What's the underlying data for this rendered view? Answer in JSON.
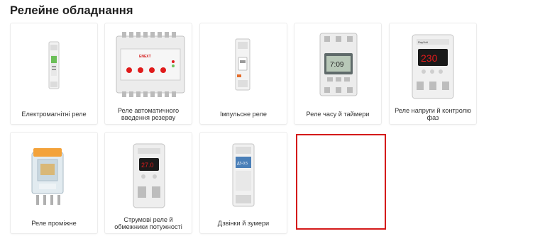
{
  "section": {
    "title": "Релейне обладнання"
  },
  "categories": [
    {
      "label": "Електромагнітні реле"
    },
    {
      "label": "Реле автоматичного введення резерву"
    },
    {
      "label": "Імпульсне реле"
    },
    {
      "label": "Реле часу й таймери"
    },
    {
      "label": "Реле напруги й контролю фаз"
    },
    {
      "label": "Реле проміжне"
    },
    {
      "label": "Струмові реле й обмежники потужності"
    },
    {
      "label": "Дзвінки й зумери"
    },
    {
      "label": ""
    }
  ],
  "devices": {
    "avr_brand": "ENEXT",
    "timer_display": "7:09",
    "voltage_display": "230",
    "current_display": "27.0",
    "bell_label": "ДЗ-0.5",
    "small_brand": "RayVolt"
  },
  "colors": {
    "selection_border": "#d41a1a",
    "led_red": "#e01b1b",
    "relay_orange": "#f3a23a"
  }
}
